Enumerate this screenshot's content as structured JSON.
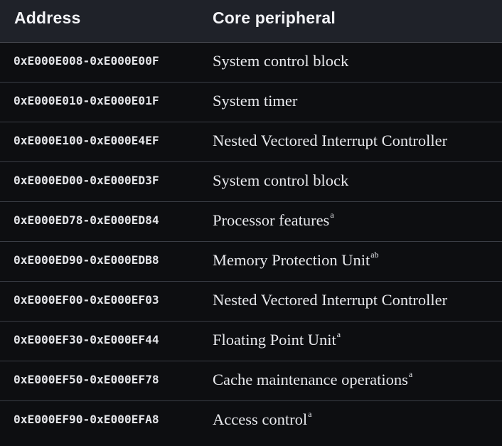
{
  "header": {
    "address_label": "Address",
    "peripheral_label": "Core peripheral"
  },
  "rows": [
    {
      "address": "0xE000E008-0xE000E00F",
      "peripheral": "System control block",
      "note": ""
    },
    {
      "address": "0xE000E010-0xE000E01F",
      "peripheral": "System timer",
      "note": ""
    },
    {
      "address": "0xE000E100-0xE000E4EF",
      "peripheral": "Nested Vectored Interrupt Controller",
      "note": ""
    },
    {
      "address": "0xE000ED00-0xE000ED3F",
      "peripheral": "System control block",
      "note": ""
    },
    {
      "address": "0xE000ED78-0xE000ED84",
      "peripheral": "Processor features",
      "note": "a"
    },
    {
      "address": "0xE000ED90-0xE000EDB8",
      "peripheral": "Memory Protection Unit",
      "note": "ab"
    },
    {
      "address": "0xE000EF00-0xE000EF03",
      "peripheral": "Nested Vectored Interrupt Controller",
      "note": ""
    },
    {
      "address": "0xE000EF30-0xE000EF44",
      "peripheral": "Floating Point Unit",
      "note": "a"
    },
    {
      "address": "0xE000EF50-0xE000EF78",
      "peripheral": "Cache maintenance operations",
      "note": "a"
    },
    {
      "address": "0xE000EF90-0xE000EFA8",
      "peripheral": "Access control",
      "note": "a"
    }
  ]
}
